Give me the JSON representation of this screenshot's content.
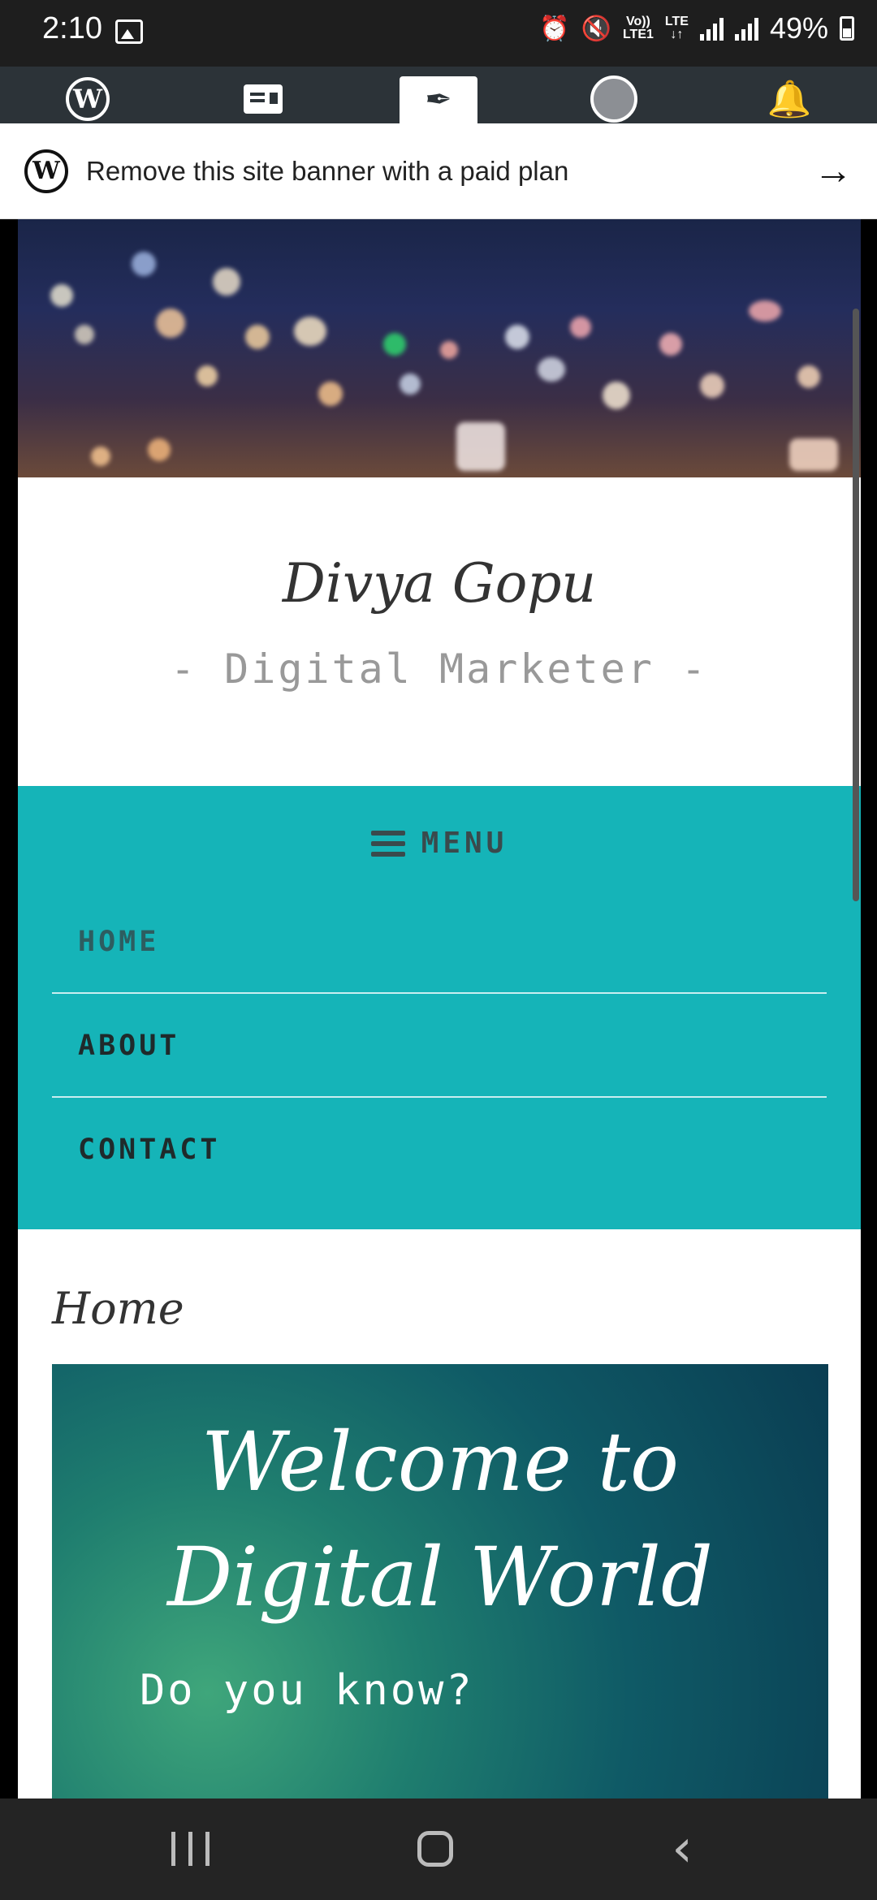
{
  "status_bar": {
    "time": "2:10",
    "lte_top": "Vo))",
    "lte_bottom": "LTE1",
    "lte_label": "LTE",
    "battery": "49%"
  },
  "toolbar": {
    "items": [
      "wordpress-logo",
      "reader-icon",
      "write-icon",
      "avatar-icon",
      "notifications-icon"
    ]
  },
  "banner": {
    "text": "Remove this site banner with a paid plan"
  },
  "site": {
    "title": "Divya Gopu",
    "tagline": "- Digital Marketer -"
  },
  "nav": {
    "menu_label": "MENU",
    "items": [
      "HOME",
      "ABOUT",
      "CONTACT"
    ]
  },
  "entry": {
    "title": "Home",
    "hero_title": "Welcome to Digital World",
    "hero_subtitle": "Do you know?"
  },
  "colors": {
    "nav_bg": "#15b4b8",
    "toolbar_bg": "#2c3338"
  }
}
